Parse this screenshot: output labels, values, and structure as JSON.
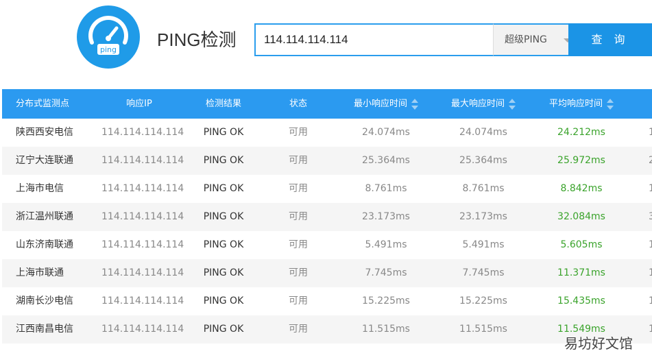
{
  "header": {
    "logo_text": "ping",
    "title": "PING检测",
    "search_value": "114.114.114.114",
    "select_value": "超级PING",
    "search_button": "查 询"
  },
  "table": {
    "columns": [
      "分布式监测点",
      "响应IP",
      "检测结果",
      "状态",
      "最小响应时间",
      "最大响应时间",
      "平均响应时间"
    ],
    "rows": [
      {
        "location": "陕西西安电信",
        "ip": "114.114.114.114",
        "result": "PING OK",
        "status": "可用",
        "min": "24.074ms",
        "max": "24.074ms",
        "avg": "24.212ms"
      },
      {
        "location": "辽宁大连联通",
        "ip": "114.114.114.114",
        "result": "PING OK",
        "status": "可用",
        "min": "25.364ms",
        "max": "25.364ms",
        "avg": "25.972ms"
      },
      {
        "location": "上海市电信",
        "ip": "114.114.114.114",
        "result": "PING OK",
        "status": "可用",
        "min": "8.761ms",
        "max": "8.761ms",
        "avg": "8.842ms"
      },
      {
        "location": "浙江温州联通",
        "ip": "114.114.114.114",
        "result": "PING OK",
        "status": "可用",
        "min": "23.173ms",
        "max": "23.173ms",
        "avg": "32.084ms"
      },
      {
        "location": "山东济南联通",
        "ip": "114.114.114.114",
        "result": "PING OK",
        "status": "可用",
        "min": "5.491ms",
        "max": "5.491ms",
        "avg": "5.605ms"
      },
      {
        "location": "上海市联通",
        "ip": "114.114.114.114",
        "result": "PING OK",
        "status": "可用",
        "min": "7.745ms",
        "max": "7.745ms",
        "avg": "11.371ms"
      },
      {
        "location": "湖南长沙电信",
        "ip": "114.114.114.114",
        "result": "PING OK",
        "status": "可用",
        "min": "15.225ms",
        "max": "15.225ms",
        "avg": "15.435ms"
      },
      {
        "location": "江西南昌电信",
        "ip": "114.114.114.114",
        "result": "PING OK",
        "status": "可用",
        "min": "11.515ms",
        "max": "11.515ms",
        "avg": "11.549ms"
      }
    ],
    "trailing_marks": [
      "1",
      "2",
      "1",
      "3",
      "1",
      "1",
      "1",
      "1"
    ]
  },
  "watermark": "易坊好文馆",
  "colors": {
    "accent": "#2b9af0",
    "button": "#1b94e6",
    "avg_green": "#3aa32b",
    "muted_text": "#888888"
  },
  "icons": {
    "logo": "speedometer-icon",
    "select_caret": "caret-down-icon",
    "sort": "sort-arrows-icon"
  }
}
